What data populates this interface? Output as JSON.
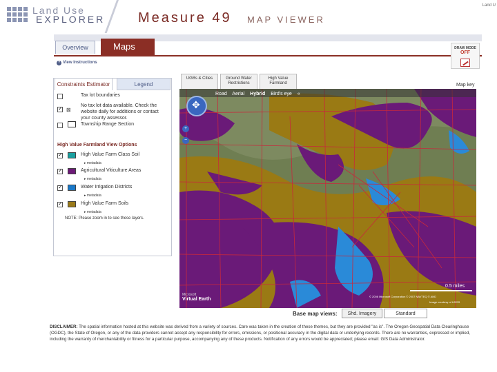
{
  "header": {
    "logo_top": "Land Use",
    "logo_bottom": "EXPLORER",
    "title_main": "Measure 49",
    "title_sub": "MAP VIEWER",
    "corner_link": "Land U"
  },
  "nav": {
    "tabs": [
      {
        "label": "Overview",
        "active": false
      },
      {
        "label": "Maps",
        "active": true
      }
    ],
    "active_color": "#8b2e25"
  },
  "draw_mode": {
    "label": "DRAW MODE",
    "state": "OFF"
  },
  "view_instructions": "View Instructions",
  "left_panel": {
    "tabs": [
      "Constraints Estimator",
      "Legend"
    ],
    "constraint_rows": [
      {
        "label": "Tax lot boundaries",
        "checked": false
      },
      {
        "label": "No tax lot data available. Check the website daily for additions or contact your county assessor.",
        "checked": true
      },
      {
        "label": "Township Range Section",
        "checked": false
      }
    ],
    "section_title": "High Value Farmland View Options",
    "farmland_rows": [
      {
        "label": "High Value Farm Class Soil",
        "color": "#1aa0a0",
        "metadata": "metadata",
        "checked": true
      },
      {
        "label": "Agricultural Viticulture Areas",
        "color": "#6d1a78",
        "metadata": "metadata",
        "checked": true
      },
      {
        "label": "Water Irrigation Districts",
        "color": "#1a78c8",
        "metadata": "metadata",
        "checked": true
      },
      {
        "label": "High Value Farm Soils",
        "color": "#9a7a1a",
        "metadata": "metadata",
        "checked": true
      }
    ],
    "note": "NOTE: Please zoom in to see these layers."
  },
  "map": {
    "tabs": [
      {
        "label": "UGBs & Cities"
      },
      {
        "label": "Ground Water Restrictions"
      },
      {
        "label": "High Value Farmland"
      }
    ],
    "map_key": "Map key",
    "map_types": [
      "Road",
      "Aerial",
      "Hybrid",
      "Bird's eye"
    ],
    "map_type_selected": "Hybrid",
    "scale": "0.5 miles",
    "ve_logo_top": "Microsoft",
    "ve_logo_bottom": "Virtual Earth",
    "copyright_1": "© 2008 Microsoft Corporation  © 2007 NAVTEQ  © AND",
    "copyright_2": "Image courtesy of USGS",
    "colors": {
      "purple": "#6a1a78",
      "gold": "#9a7a14",
      "blue": "#2a8ad8",
      "red": "#c8283c",
      "aerial": "#6f7e52"
    }
  },
  "basemap": {
    "label": "Base map views:",
    "options": [
      "Shd. Imagery",
      "Standard"
    ],
    "selected": "Shd. Imagery"
  },
  "disclaimer": {
    "lead": "DISCLAIMER:",
    "text": "The spatial information hosted at this website was derived from a variety of sources. Care was taken in the creation of these themes, but they are provided \"as is\". The Oregon Geospatial Data Clearinghouse (OGDC), the State of Oregon, or any of the data providers cannot accept any responsibility for errors, omissions, or positional accuracy in the digital data or underlying records. There are no warranties, expressed or implied, including the warranty of merchantability or fitness for a particular purpose, accompanying any of these products. Notification of any errors would be appreciated; please email: GIS Data Administrator."
  }
}
